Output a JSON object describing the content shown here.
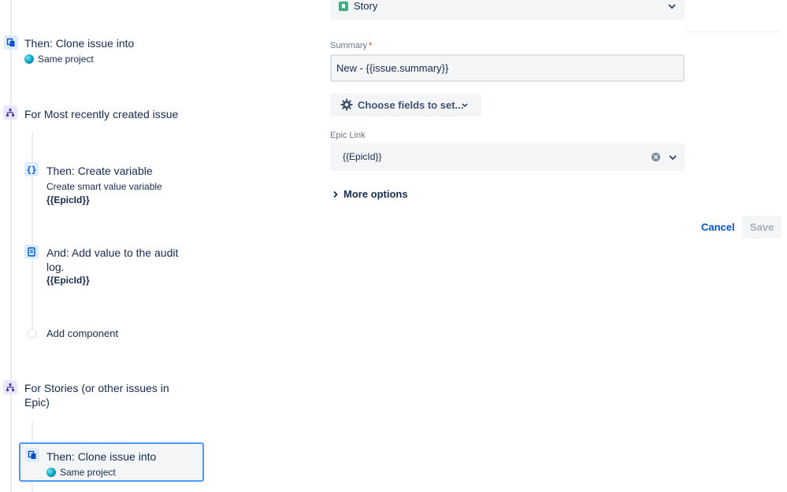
{
  "rule_panel": {
    "clone_step_1": {
      "title": "Then: Clone issue into",
      "target": "Same project"
    },
    "branch_recent": {
      "title": "For Most recently created issue"
    },
    "create_variable": {
      "title": "Then: Create variable",
      "subtitle": "Create smart value variable",
      "value": "{{EpicId}}"
    },
    "audit_log": {
      "title_line1": "And: Add value to the audit",
      "title_line2": "log.",
      "value": "{{EpicId}}"
    },
    "add_component": {
      "label": "Add component"
    },
    "branch_stories": {
      "title_line1": "For Stories (or other issues in",
      "title_line2": "Epic)"
    },
    "clone_step_2": {
      "title": "Then: Clone issue into",
      "target": "Same project"
    }
  },
  "config_panel": {
    "issue_type": {
      "value": "Story",
      "color": "#36b37e"
    },
    "summary": {
      "label": "Summary",
      "required_mark": "*",
      "value": "New - {{issue.summary}}"
    },
    "choose_fields": {
      "label": "Choose fields to set..."
    },
    "epic_link": {
      "label": "Epic Link",
      "value": "{{EpicId}}"
    },
    "more_options": {
      "label": "More options"
    },
    "cancel_label": "Cancel",
    "save_label": "Save"
  },
  "colors": {
    "accent": "#0052cc",
    "selection_border": "#4c9aff",
    "action_icon_bg": "#deebff",
    "branch_icon_bg": "#eae6ff"
  },
  "icons": {
    "clone": "clone-icon",
    "branch": "branch-icon",
    "variable": "braces-icon",
    "audit": "audit-log-icon",
    "settings": "gear-icon",
    "story": "story-icon"
  }
}
